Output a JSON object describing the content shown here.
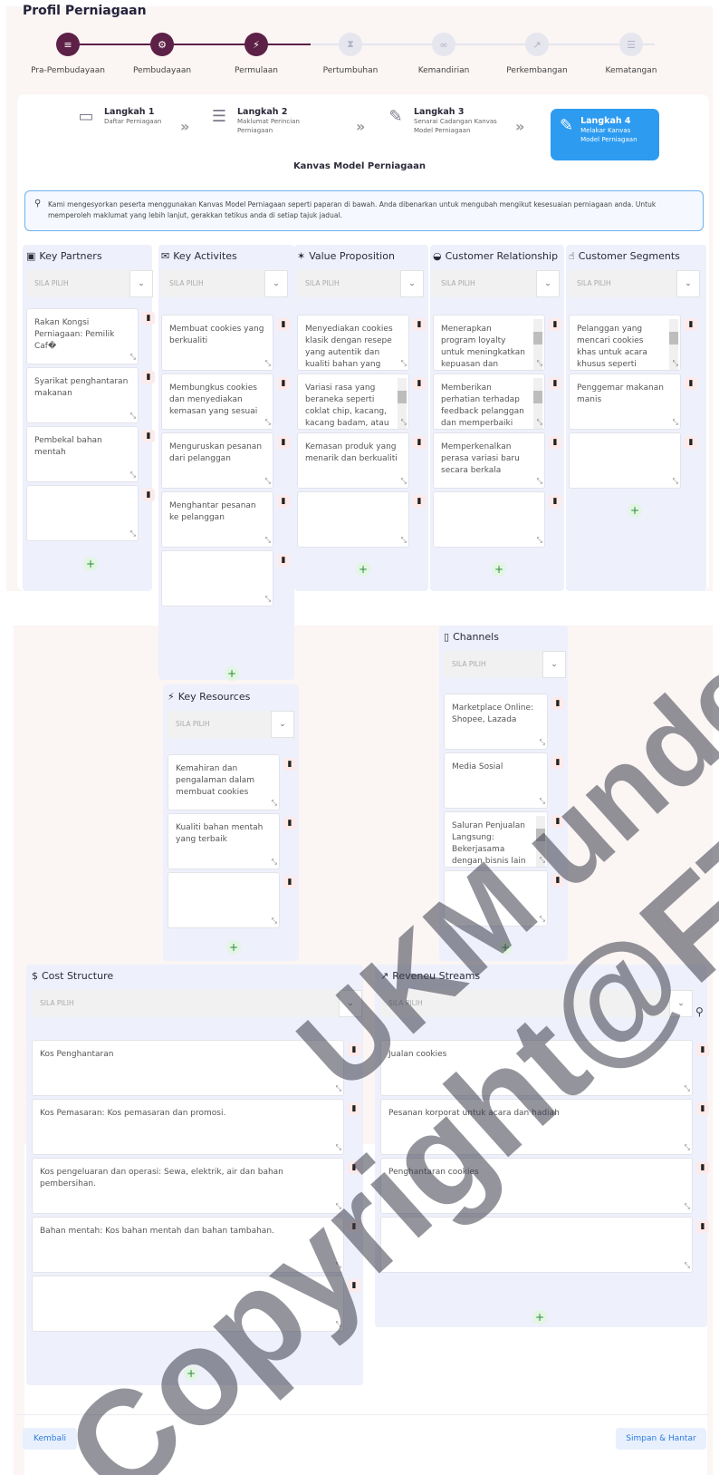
{
  "title": "Profil Perniagaan",
  "stages": [
    {
      "label": "Pra-Pembudayaan",
      "icon": "gauge-icon",
      "done": true
    },
    {
      "label": "Pembudayaan",
      "icon": "settings-icon",
      "done": true
    },
    {
      "label": "Permulaan",
      "icon": "bolt-icon",
      "done": true
    },
    {
      "label": "Pertumbuhan",
      "icon": "hourglass-icon",
      "done": false
    },
    {
      "label": "Kemandirian",
      "icon": "link-icon",
      "done": false
    },
    {
      "label": "Perkembangan",
      "icon": "trend-icon",
      "done": false
    },
    {
      "label": "Kematangan",
      "icon": "network-icon",
      "done": false
    }
  ],
  "wizard": [
    {
      "title": "Langkah 1",
      "sub": "Daftar Perniagaan",
      "icon": "monitor-icon"
    },
    {
      "title": "Langkah 2",
      "sub": "Maklumat Perincian Perniagaan",
      "icon": "list-icon"
    },
    {
      "title": "Langkah 3",
      "sub": "Senarai Cadangan Kanvas Model Perniagaan",
      "icon": "pen-icon"
    },
    {
      "title": "Langkah 4",
      "sub": "Melakar Kanvas Model Perniagaan",
      "icon": "brush-icon"
    }
  ],
  "canvas_title": "Kanvas Model Perniagaan",
  "info_text": "Kami mengesyorkan peserta menggunakan Kanvas Model Perniagaan seperti paparan di bawah. Anda dibenarkan untuk mengubah mengikut kesesuaian perniagaan anda. Untuk memperoleh maklumat yang lebih lanjut, gerakkan tetikus anda di setiap tajuk jadual.",
  "select_placeholder": "SILA PILIH",
  "sections": {
    "key_partners": {
      "title": "Key Partners",
      "icon": "partners-icon",
      "items": [
        "Rakan Kongsi Perniagaan: Pemilik Caf�",
        "Syarikat penghantaran makanan",
        "Pembekal bahan mentah",
        ""
      ]
    },
    "key_activities": {
      "title": "Key Activites",
      "icon": "envelope-icon",
      "items": [
        "Membuat cookies yang berkualiti",
        "Membungkus cookies dan menyediakan kemasan yang sesuai",
        "Menguruskan pesanan dari pelanggan",
        "Menghantar pesanan ke pelanggan",
        ""
      ]
    },
    "value_proposition": {
      "title": "Value Proposition",
      "icon": "gift-icon",
      "items": [
        "Menyediakan cookies klasik dengan resepe yang autentik dan kualiti bahan yang terbaik.",
        "Variasi rasa yang beraneka seperti coklat chip, kacang, kacang badam, atau kacang almond",
        "Kemasan produk yang menarik dan berkualiti",
        ""
      ]
    },
    "customer_relationship": {
      "title": "Customer Relationship",
      "icon": "heart-icon",
      "items": [
        "Menerapkan program loyalty untuk meningkatkan kepuasan dan kesetiaan pelanggan",
        "Memberikan perhatian terhadap feedback pelanggan dan memperbaiki kelemahan yang",
        "Memperkenalkan perasa variasi baru secara berkala",
        ""
      ]
    },
    "customer_segments": {
      "title": "Customer Segments",
      "icon": "thumbs-up-icon",
      "items": [
        "Pelanggan yang mencari cookies khas untuk acara khusus seperti perkahwinan, ulang",
        "Penggemar makanan manis",
        ""
      ]
    },
    "key_resources": {
      "title": "Key Resources",
      "icon": "bolt-icon",
      "items": [
        "Kemahiran dan pengalaman dalam membuat cookies",
        "Kualiti bahan mentah yang terbaik",
        ""
      ]
    },
    "channels": {
      "title": "Channels",
      "icon": "phone-icon",
      "items": [
        "Marketplace Online: Shopee, Lazada",
        "Media Sosial",
        "Saluran Penjualan Langsung: Bekerjasama dengan bisnis lain seperti caf�",
        ""
      ]
    },
    "cost_structure": {
      "title": "Cost Structure",
      "icon": "dollar-icon",
      "items": [
        "Kos Penghantaran",
        "Kos Pemasaran: Kos pemasaran dan promosi.",
        "Kos pengeluaran dan operasi: Sewa, elektrik, air dan bahan pembersihan.",
        "Bahan mentah:  Kos bahan mentah dan bahan tambahan.",
        ""
      ]
    },
    "revenue_streams": {
      "title": "Reveneu Streams",
      "icon": "chart-line-icon",
      "items": [
        "Jualan cookies",
        "Pesanan korporat untuk acara dan hadiah",
        "Penghantaran cookies",
        ""
      ]
    }
  },
  "buttons": {
    "back": "Kembali",
    "submit": "Simpan & Hantar"
  },
  "watermark": "Copyright@FTSM UKM"
}
